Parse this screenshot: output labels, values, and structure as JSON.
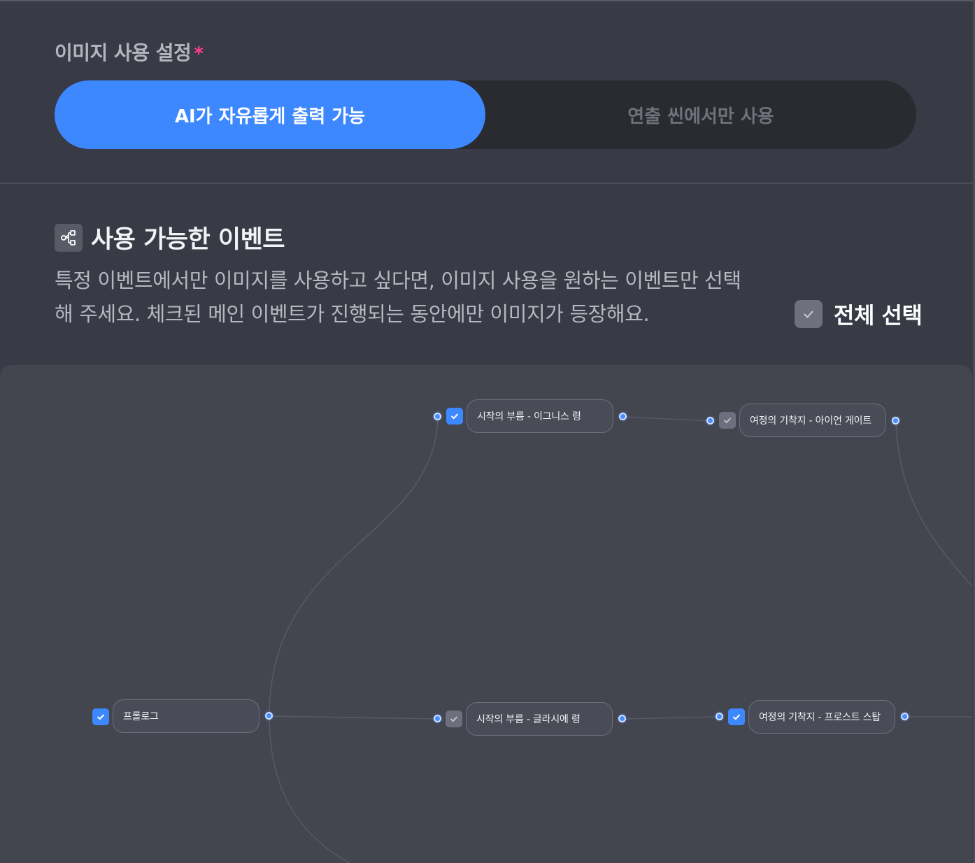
{
  "image_settings": {
    "title": "이미지 사용 설정",
    "required_mark": "*",
    "options": [
      {
        "label": "AI가 자유롭게 출력 가능",
        "selected": true
      },
      {
        "label": "연출 씬에서만 사용",
        "selected": false
      }
    ]
  },
  "events": {
    "icon": "share-graph-icon",
    "title": "사용 가능한 이벤트",
    "description_line1": "특정 이벤트에서만 이미지를 사용하고 싶다면, 이미지 사용을 원하는 이벤트만 선택",
    "description_line2": "해 주세요. 체크된 메인 이벤트가 진행되는 동안에만 이미지가 등장해요.",
    "select_all_label": "전체 선택",
    "select_all_checked": false
  },
  "graph": {
    "nodes": [
      {
        "label": "프롤로그",
        "checked": true
      },
      {
        "label": "시작의 부름 - 이그니스 령",
        "checked": true
      },
      {
        "label": "시작의 부름 - 글라시에 령",
        "checked": false
      },
      {
        "label": "여정의 기착지 - 아이언 게이트",
        "checked": false
      },
      {
        "label": "여정의 기착지 - 프로스트 스탑",
        "checked": true
      }
    ],
    "colors": {
      "accent": "#3e88ff",
      "node_bg": "#494b56",
      "edge": "#575a66",
      "unchecked": "#6d707c"
    }
  }
}
